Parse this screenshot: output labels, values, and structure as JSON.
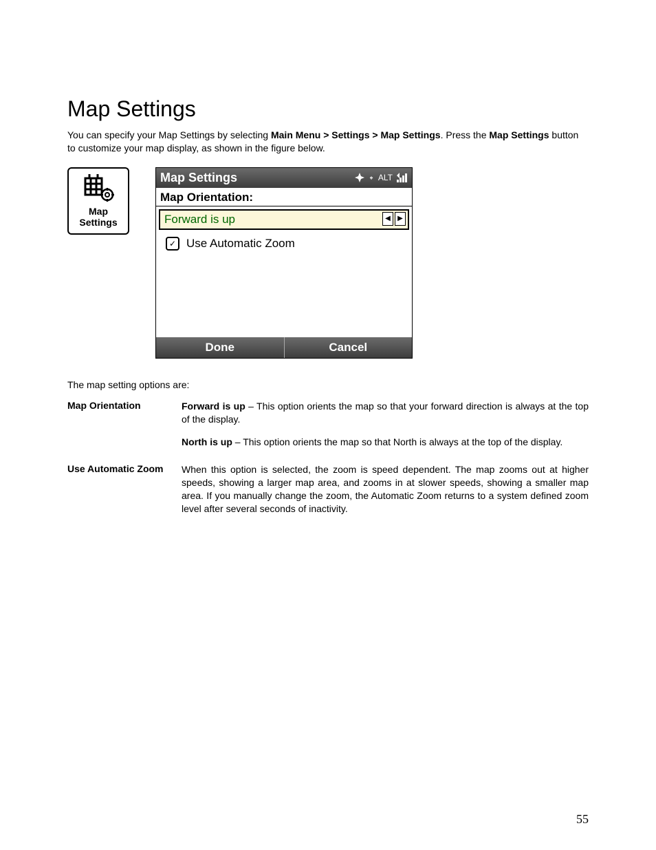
{
  "heading": "Map Settings",
  "intro": {
    "pre": "You can specify your Map Settings by selecting ",
    "path": "Main Menu > Settings > Map Settings",
    "mid": ". Press the ",
    "bold2": "Map Settings",
    "post": " button to customize your map display, as shown in the figure below."
  },
  "tile": {
    "line1": "Map",
    "line2": "Settings"
  },
  "screen": {
    "title": "Map Settings",
    "status_alt": "ALT",
    "section_label": "Map Orientation:",
    "select_value": "Forward is up",
    "checkbox_label": "Use Automatic Zoom",
    "done": "Done",
    "cancel": "Cancel"
  },
  "options_intro": "The map setting options are:",
  "options": [
    {
      "label": "Map Orientation",
      "paragraphs": [
        {
          "bold": "Forward is up",
          "rest": " – This option orients the map so that your forward direction is always at the top of the display."
        },
        {
          "bold": "North is up",
          "rest": " – This option orients the map so that North is always at the top of the display."
        }
      ]
    },
    {
      "label": "Use Automatic Zoom",
      "paragraphs": [
        {
          "bold": "",
          "rest": "When this option is selected, the zoom is speed dependent. The map zooms out at higher speeds, showing a larger map area, and zooms in at slower speeds, showing a smaller map area. If you manually change the zoom, the Automatic Zoom returns to a system defined zoom level after several seconds of inactivity."
        }
      ]
    }
  ],
  "page_number": "55"
}
